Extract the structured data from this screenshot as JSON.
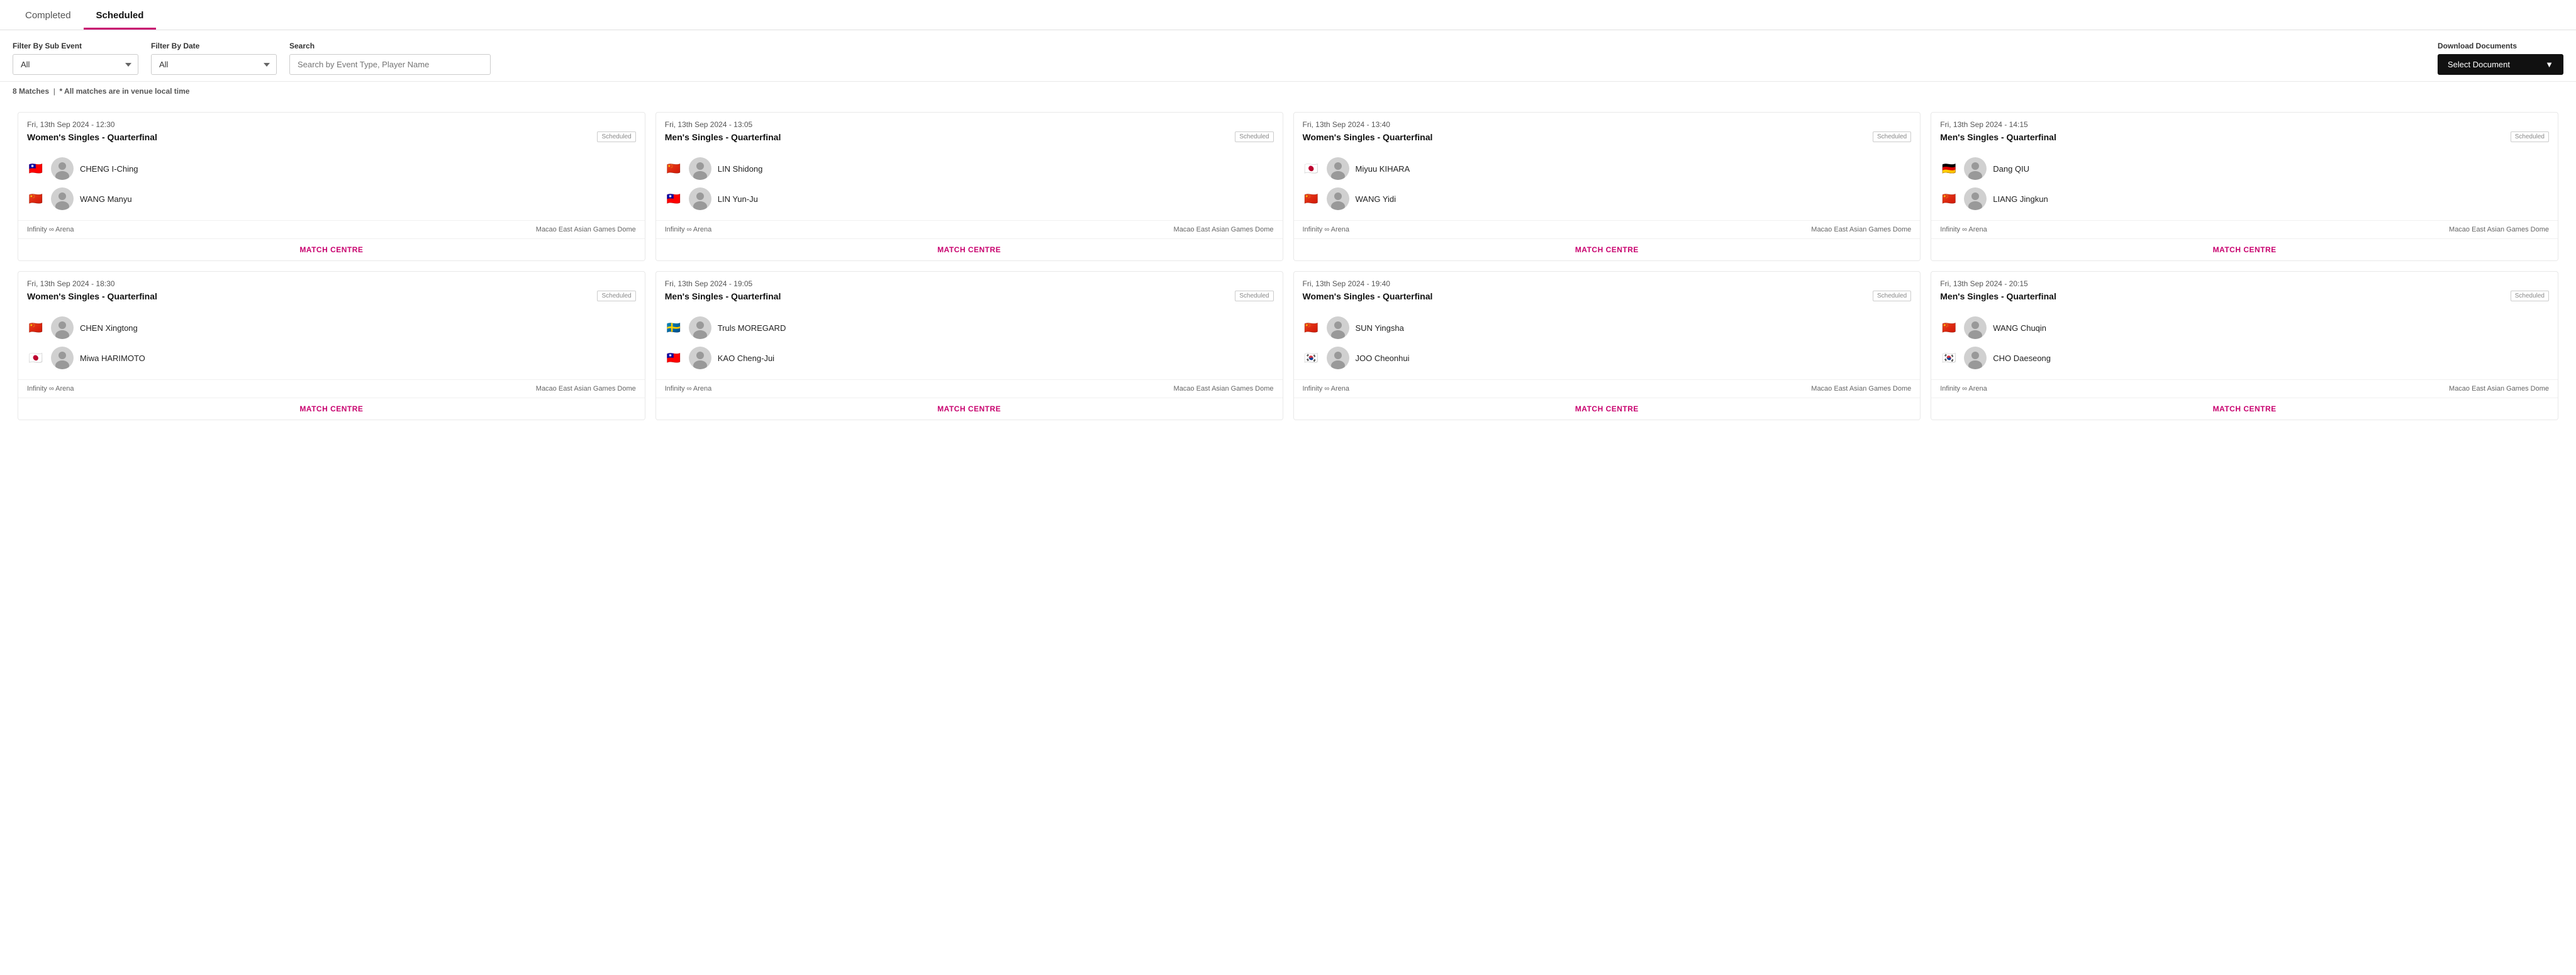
{
  "tabs": [
    {
      "id": "completed",
      "label": "Completed",
      "active": false
    },
    {
      "id": "scheduled",
      "label": "Scheduled",
      "active": true
    }
  ],
  "filters": {
    "sub_event_label": "Filter By Sub Event",
    "sub_event_value": "All",
    "date_label": "Filter By Date",
    "date_value": "All",
    "search_label": "Search",
    "search_placeholder": "Search by Event Type, Player Name",
    "download_label": "Download Documents",
    "download_btn": "Select Document"
  },
  "matches_info": {
    "count": "8 Matches",
    "note": "* All matches are in venue local time"
  },
  "matches": [
    {
      "datetime": "Fri, 13th Sep 2024 - 12:30",
      "event": "Women's Singles - Quarterfinal",
      "status": "Scheduled",
      "players": [
        {
          "flag": "🇹🇼",
          "avatar": "👤",
          "name": "CHENG I-Ching"
        },
        {
          "flag": "🇨🇳",
          "avatar": "👤",
          "name": "WANG Manyu"
        }
      ],
      "venue": "Infinity ∞ Arena",
      "venue2": "Macao East Asian Games Dome"
    },
    {
      "datetime": "Fri, 13th Sep 2024 - 13:05",
      "event": "Men's Singles - Quarterfinal",
      "status": "Scheduled",
      "players": [
        {
          "flag": "🇨🇳",
          "avatar": "👤",
          "name": "LIN Shidong"
        },
        {
          "flag": "🇹🇼",
          "avatar": "👤",
          "name": "LIN Yun-Ju"
        }
      ],
      "venue": "Infinity ∞ Arena",
      "venue2": "Macao East Asian Games Dome"
    },
    {
      "datetime": "Fri, 13th Sep 2024 - 13:40",
      "event": "Women's Singles - Quarterfinal",
      "status": "Scheduled",
      "players": [
        {
          "flag": "🇯🇵",
          "avatar": "👤",
          "name": "Miyuu KIHARA"
        },
        {
          "flag": "🇨🇳",
          "avatar": "👤",
          "name": "WANG Yidi"
        }
      ],
      "venue": "Infinity ∞ Arena",
      "venue2": "Macao East Asian Games Dome"
    },
    {
      "datetime": "Fri, 13th Sep 2024 - 14:15",
      "event": "Men's Singles - Quarterfinal",
      "status": "Scheduled",
      "players": [
        {
          "flag": "🇩🇪",
          "avatar": "👤",
          "name": "Dang QIU"
        },
        {
          "flag": "🇨🇳",
          "avatar": "👤",
          "name": "LIANG Jingkun"
        }
      ],
      "venue": "Infinity ∞ Arena",
      "venue2": "Macao East Asian Games Dome"
    },
    {
      "datetime": "Fri, 13th Sep 2024 - 18:30",
      "event": "Women's Singles - Quarterfinal",
      "status": "Scheduled",
      "players": [
        {
          "flag": "🇨🇳",
          "avatar": "👤",
          "name": "CHEN Xingtong"
        },
        {
          "flag": "🇯🇵",
          "avatar": "👤",
          "name": "Miwa HARIMOTO"
        }
      ],
      "venue": "Infinity ∞ Arena",
      "venue2": "Macao East Asian Games Dome"
    },
    {
      "datetime": "Fri, 13th Sep 2024 - 19:05",
      "event": "Men's Singles - Quarterfinal",
      "status": "Scheduled",
      "players": [
        {
          "flag": "🇸🇪",
          "avatar": "👤",
          "name": "Truls MOREGARD"
        },
        {
          "flag": "🇹🇼",
          "avatar": "👤",
          "name": "KAO Cheng-Jui"
        }
      ],
      "venue": "Infinity ∞ Arena",
      "venue2": "Macao East Asian Games Dome"
    },
    {
      "datetime": "Fri, 13th Sep 2024 - 19:40",
      "event": "Women's Singles - Quarterfinal",
      "status": "Scheduled",
      "players": [
        {
          "flag": "🇨🇳",
          "avatar": "👤",
          "name": "SUN Yingsha"
        },
        {
          "flag": "🇰🇷",
          "avatar": "👤",
          "name": "JOO Cheonhui"
        }
      ],
      "venue": "Infinity ∞ Arena",
      "venue2": "Macao East Asian Games Dome"
    },
    {
      "datetime": "Fri, 13th Sep 2024 - 20:15",
      "event": "Men's Singles - Quarterfinal",
      "status": "Scheduled",
      "players": [
        {
          "flag": "🇨🇳",
          "avatar": "👤",
          "name": "WANG Chuqin"
        },
        {
          "flag": "🇰🇷",
          "avatar": "👤",
          "name": "CHO Daeseong"
        }
      ],
      "venue": "Infinity ∞ Arena",
      "venue2": "Macao East Asian Games Dome"
    }
  ],
  "match_centre_label": "MATCH CENTRE"
}
